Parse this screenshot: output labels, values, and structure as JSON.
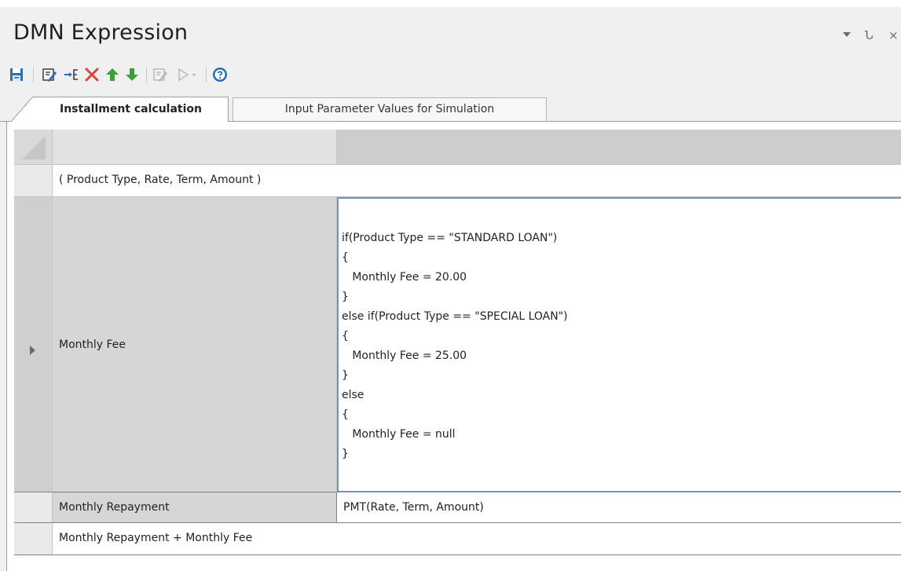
{
  "window": {
    "title": "DMN Expression",
    "controls": [
      "dropdown-arrow-icon",
      "pin-icon",
      "close-icon"
    ],
    "pin_glyph": "Ն",
    "close_glyph": "×"
  },
  "toolbar": {
    "icons": [
      "save-icon",
      "edit-icon",
      "insert-icon",
      "delete-icon",
      "move-up-icon",
      "move-down-icon",
      "validate-icon",
      "run-icon",
      "run-dropdown-icon",
      "help-icon"
    ]
  },
  "tabs": [
    {
      "label": "Installment calculation",
      "active": true
    },
    {
      "label": "Input Parameter Values for Simulation",
      "active": false
    }
  ],
  "grid": {
    "parameters": "( Product Type, Rate, Term, Amount )",
    "rows": [
      {
        "name": "Monthly Fee",
        "expression_lines": [
          "if(Product Type == \"STANDARD LOAN\")",
          "{",
          "   Monthly Fee = 20.00",
          "}",
          "else if(Product Type == \"SPECIAL LOAN\")",
          "{",
          "   Monthly Fee = 25.00",
          "}",
          "else",
          "{",
          "   Monthly Fee = null",
          "}"
        ]
      },
      {
        "name": "Monthly Repayment",
        "expression": "PMT(Rate, Term, Amount)"
      }
    ],
    "result": "Monthly Repayment + Monthly Fee"
  },
  "colors": {
    "panel_bg": "#f0f0f0",
    "selection_border": "#6a93c8",
    "save_blue": "#2a6ebb",
    "delete_red": "#e04040",
    "arrow_green": "#3aa03a",
    "help_blue": "#1f6fbf"
  }
}
